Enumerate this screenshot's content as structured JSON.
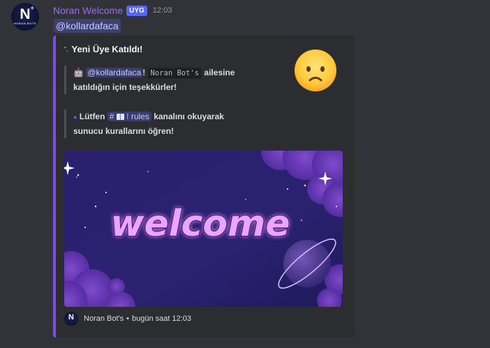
{
  "message": {
    "author": "Noran Welcome",
    "app_tag": "UYG",
    "time": "12:03",
    "content_mention": "@kollardafaca"
  },
  "avatar": {
    "letter": "N",
    "sub": "NORAN BOTS"
  },
  "embed": {
    "accent_color": "#7b4ee6",
    "title": "Yeni Üye Katıldı!",
    "line1": {
      "mention": "@kollardafaca",
      "exclaim": "!",
      "code": "Noran Bot's",
      "text_a": "ailesine",
      "text_b": "katıldığın için teşekkürler!"
    },
    "line2": {
      "prefix": "Lütfen",
      "channel_hash": "#",
      "channel_name": "rules",
      "text_a": "kanalını okuyarak",
      "text_b": "sunucu kurallarını öğren!"
    },
    "image": {
      "word": "welcome"
    },
    "footer": {
      "name": "Noran Bot's",
      "sep": "•",
      "time": "bugün saat 12:03"
    }
  }
}
